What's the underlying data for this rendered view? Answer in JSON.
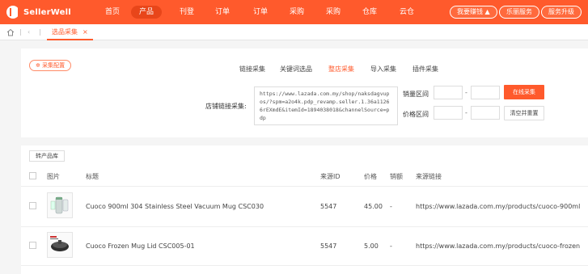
{
  "header": {
    "brand": "SellerWell",
    "nav": [
      "首页",
      "产品",
      "刊登",
      "订单",
      "订单",
      "采购",
      "采购",
      "仓库",
      "云仓"
    ],
    "active_nav_index": 1,
    "pills": [
      "我要赚钱",
      "乐丽服务",
      "服务升级"
    ],
    "colors": {
      "brand": "#ff5a2c"
    }
  },
  "tabbar": {
    "current_tab": "选品采集",
    "close_glyph": "×"
  },
  "collector": {
    "settings_label": "采集配置",
    "modes": [
      "链接采集",
      "关键词选品",
      "整店采集",
      "导入采集",
      "插件采集"
    ],
    "active_mode_index": 2,
    "shop_link_label": "店铺链接采集:",
    "shop_link_value": "https://www.lazada.com.my/shop/naksdagvupos/?spm=a2o4k.pdp_revamp.seller.1.36a11266rEXmdE&itemId=1894038018&channelSource=pdp",
    "sales_range_label": "销量区间",
    "price_range_label": "价格区间",
    "dash": "-",
    "start_button": "在线采集",
    "clear_button": "清空并重置"
  },
  "table": {
    "store_button": "转产品库",
    "columns": [
      "图片",
      "标题",
      "来源ID",
      "价格",
      "销额",
      "来源链接"
    ],
    "rows": [
      {
        "title": "Cuoco 900ml 304 Stainless Steel Vacuum Mug CSC030",
        "source_id": "5547",
        "price": "45.00",
        "sales": "-",
        "link": "https://www.lazada.com.my/products/cuoco-900ml"
      },
      {
        "title": "Cuoco Frozen Mug Lid CSC005-01",
        "source_id": "5547",
        "price": "5.00",
        "sales": "-",
        "link": "https://www.lazada.com.my/products/cuoco-frozen"
      }
    ]
  }
}
